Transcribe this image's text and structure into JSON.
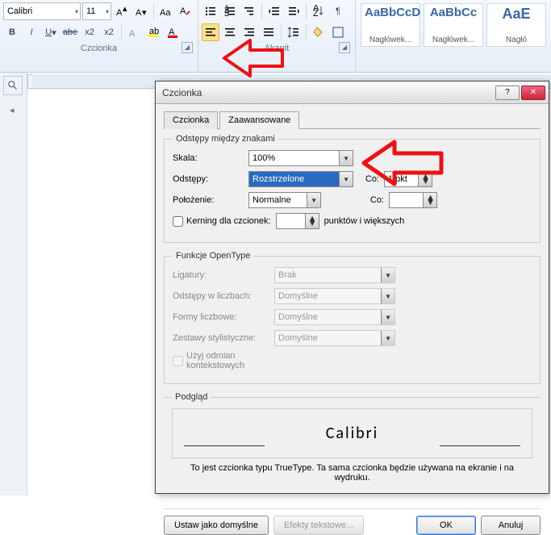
{
  "ribbon": {
    "font_name": "Calibri",
    "font_size": "11",
    "group_font_label": "Czcionka",
    "group_para_label": "Akapit",
    "styles": [
      {
        "sample": "AaBbCcD",
        "name": "Nagłówek..."
      },
      {
        "sample": "AaBbCc",
        "name": "Nagłówek..."
      },
      {
        "sample": "AaE",
        "name": "Nagłó"
      }
    ]
  },
  "ruler_corner": "L",
  "dialog": {
    "title": "Czcionka",
    "tabs": {
      "font": "Czcionka",
      "advanced": "Zaawansowane"
    },
    "spacing_legend": "Odstępy między znakami",
    "scale_label": "Skala:",
    "scale_value": "100%",
    "spacing_label": "Odstępy:",
    "spacing_value": "Rozstrzelone",
    "spacing_by_label": "Co:",
    "spacing_by_value": "1 pkt",
    "position_label": "Położenie:",
    "position_value": "Normalne",
    "position_by_label": "Co:",
    "position_by_value": "",
    "kerning_label": "Kerning dla czcionek:",
    "kerning_value": "",
    "kerning_after": "punktów i większych",
    "opentype_legend": "Funkcje OpenType",
    "ligatures_label": "Ligatury:",
    "ligatures_value": "Brak",
    "numspacing_label": "Odstępy w liczbach:",
    "numspacing_value": "Domyślne",
    "numforms_label": "Formy liczbowe:",
    "numforms_value": "Domyślne",
    "stylistic_label": "Zestawy stylistyczne:",
    "stylistic_value": "Domyślne",
    "contextual_label": "Użyj odmian kontekstowych",
    "preview_legend": "Podgląd",
    "preview_text": "Calibri",
    "preview_note": "To jest czcionka typu TrueType. Ta sama czcionka będzie używana na ekranie i na wydruku.",
    "set_default": "Ustaw jako domyślne",
    "text_effects": "Efekty tekstowe...",
    "ok": "OK",
    "cancel": "Anuluj"
  }
}
